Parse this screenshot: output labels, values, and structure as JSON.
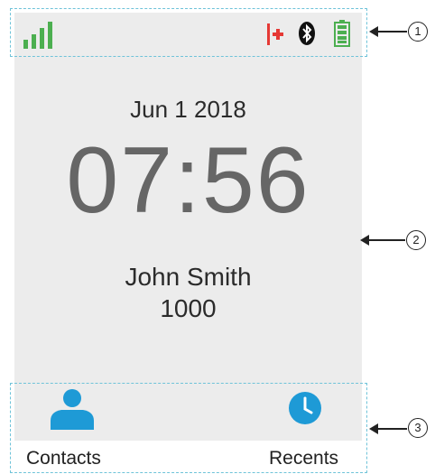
{
  "status_bar": {
    "signal_icon": "signal-bars-icon",
    "handset_icon": "handset-status-icon",
    "bluetooth_icon": "bluetooth-icon",
    "battery_icon": "battery-full-icon",
    "signal_color": "#4caf50",
    "handset_color": "#e53935",
    "battery_color": "#4caf50"
  },
  "main": {
    "date": "Jun 1 2018",
    "time": "07:56",
    "user_name": "John Smith",
    "extension": "1000"
  },
  "softkeys": {
    "contacts_label": "Contacts",
    "recents_label": "Recents",
    "contacts_icon": "person-icon",
    "recents_icon": "clock-icon",
    "accent_color": "#1e9ad6"
  },
  "callouts": {
    "label_1": "1",
    "label_2": "2",
    "label_3": "3"
  }
}
